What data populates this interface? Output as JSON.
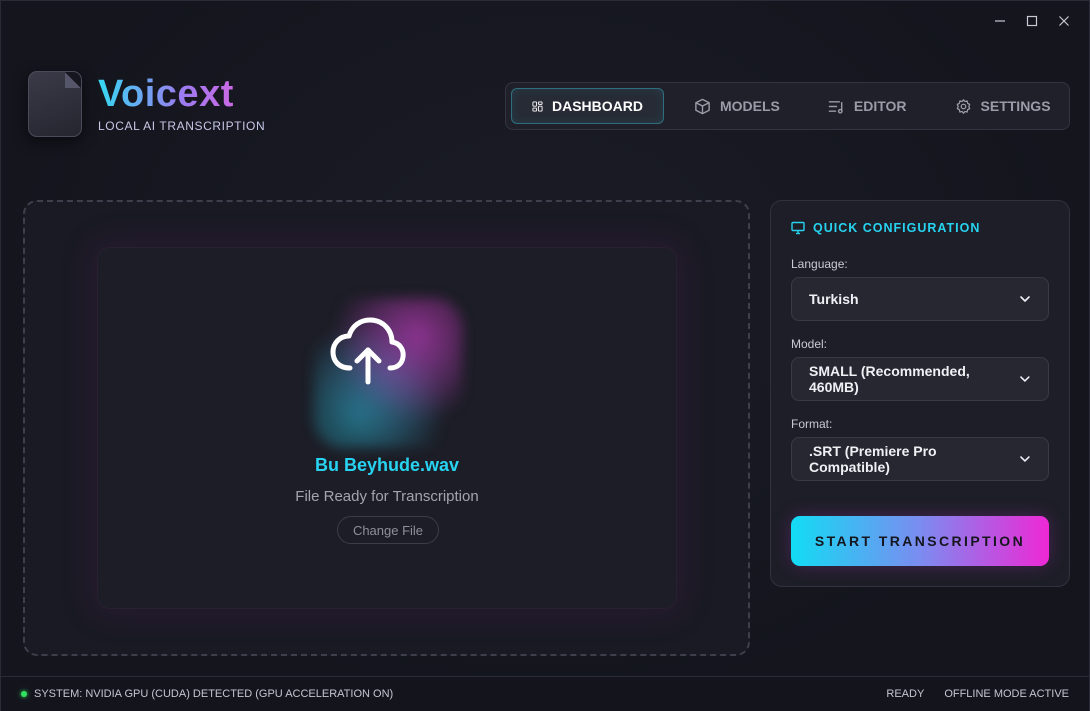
{
  "app": {
    "title": "Voicext",
    "subtitle": "LOCAL AI TRANSCRIPTION"
  },
  "window_controls": [
    "minimize-icon",
    "maximize-icon",
    "close-icon"
  ],
  "nav": {
    "items": [
      {
        "label": "DASHBOARD",
        "icon": "dashboard-grid-icon",
        "active": true
      },
      {
        "label": "MODELS",
        "icon": "cube-icon",
        "active": false
      },
      {
        "label": "EDITOR",
        "icon": "lines-edit-icon",
        "active": false
      },
      {
        "label": "SETTINGS",
        "icon": "gear-icon",
        "active": false
      }
    ]
  },
  "dropzone": {
    "icon": "cloud-upload-icon",
    "file_name": "Bu Beyhude.wav",
    "status": "File Ready for Transcription",
    "change_label": "Change File"
  },
  "config": {
    "heading": "QUICK CONFIGURATION",
    "heading_icon": "monitor-icon",
    "language_label": "Language:",
    "language_value": "Turkish",
    "model_label": "Model:",
    "model_value": "SMALL (Recommended, 460MB)",
    "format_label": "Format:",
    "format_value": ".SRT (Premiere Pro Compatible)",
    "start_label": "START TRANSCRIPTION"
  },
  "status": {
    "system": "SYSTEM: NVIDIA GPU (CUDA) DETECTED (GPU ACCELERATION ON)",
    "ready": "READY",
    "mode": "OFFLINE MODE ACTIVE"
  },
  "colors": {
    "accent_cyan": "#27d3f0",
    "accent_magenta": "#ee28d6",
    "status_green": "#32e060",
    "background": "#15161e"
  }
}
